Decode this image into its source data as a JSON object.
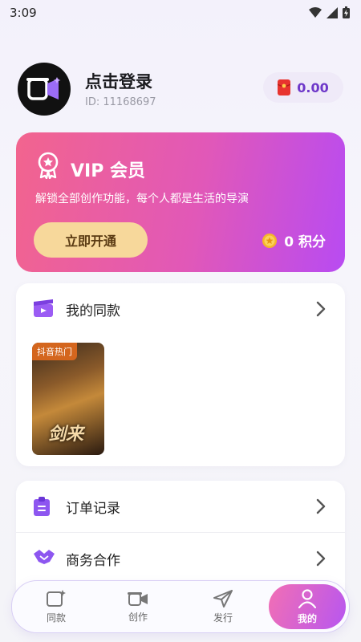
{
  "status": {
    "time": "3:09"
  },
  "profile": {
    "name": "点击登录",
    "uid": "ID: 11168697",
    "balance": "0.00"
  },
  "vip": {
    "title": "VIP 会员",
    "desc": "解锁全部创作功能，每个人都是生活的导演",
    "open_label": "立即开通",
    "points": "0 积分"
  },
  "same_style": {
    "label": "我的同款",
    "poster_tag": "抖音热门",
    "poster_title": "剑来"
  },
  "menu": [
    {
      "label": "订单记录",
      "icon": "clipboard-icon"
    },
    {
      "label": "商务合作",
      "icon": "handshake-icon"
    }
  ],
  "tabs": [
    {
      "label": "同款",
      "icon": "same-style-icon"
    },
    {
      "label": "创作",
      "icon": "camera-icon"
    },
    {
      "label": "发行",
      "icon": "send-icon"
    },
    {
      "label": "我的",
      "icon": "person-icon"
    }
  ],
  "colors": {
    "accent": "#6e38c9",
    "vip_start": "#f2648e",
    "vip_end": "#b84bf2",
    "gold_button": "#f7d89b"
  }
}
